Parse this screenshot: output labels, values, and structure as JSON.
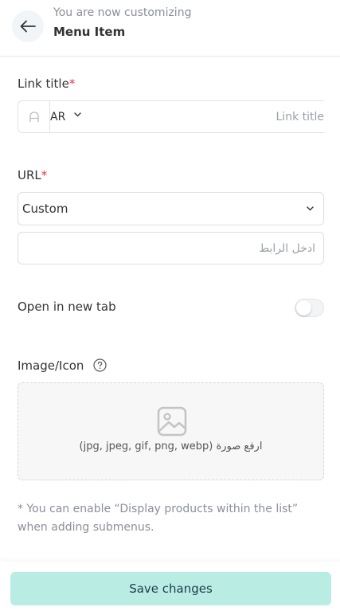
{
  "header": {
    "subtitle": "You are now customizing",
    "title": "Menu Item"
  },
  "link_title": {
    "label": "Link title",
    "required_mark": "*",
    "lang_code": "AR",
    "placeholder": "Link title"
  },
  "url": {
    "label": "URL",
    "required_mark": "*",
    "type_value": "Custom",
    "link_placeholder": "ادخل الرابط"
  },
  "open_new_tab": {
    "label": "Open in new tab",
    "enabled": false
  },
  "image_icon": {
    "label": "Image/Icon",
    "upload_text": "ارفع صورة (jpg, jpeg, gif, png, webp)"
  },
  "note": "* You can enable “Display products within the list” when adding submenus.",
  "footer": {
    "save_label": "Save changes"
  },
  "colors": {
    "accent": "#b9ede4",
    "required": "#e0344b"
  }
}
